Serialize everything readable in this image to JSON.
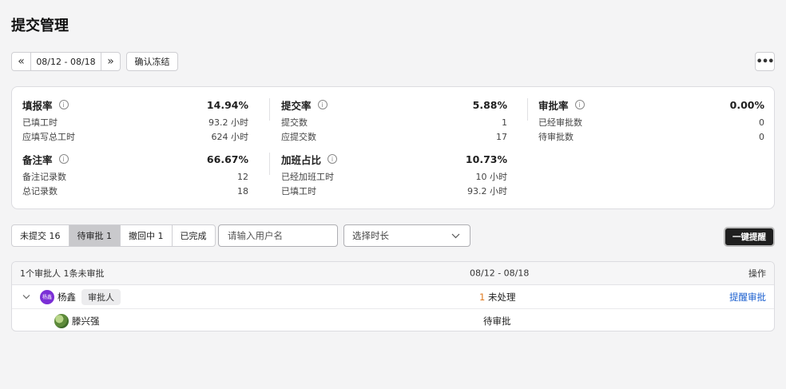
{
  "page": {
    "title": "提交管理"
  },
  "toolbar": {
    "date_range": "08/12 - 08/18",
    "prev_symbol": "«",
    "next_symbol": "»",
    "freeze_label": "确认冻结",
    "more_symbol": "•••"
  },
  "stats": {
    "fill": {
      "title": "填报率",
      "percent": "14.94%",
      "rows": [
        {
          "label": "已填工时",
          "value": "93.2 小时"
        },
        {
          "label": "应填写总工时",
          "value": "624 小时"
        }
      ]
    },
    "submit": {
      "title": "提交率",
      "percent": "5.88%",
      "rows": [
        {
          "label": "提交数",
          "value": "1"
        },
        {
          "label": "应提交数",
          "value": "17"
        }
      ]
    },
    "approve": {
      "title": "审批率",
      "percent": "0.00%",
      "rows": [
        {
          "label": "已经审批数",
          "value": "0"
        },
        {
          "label": "待审批数",
          "value": "0"
        }
      ]
    },
    "note": {
      "title": "备注率",
      "percent": "66.67%",
      "rows": [
        {
          "label": "备注记录数",
          "value": "12"
        },
        {
          "label": "总记录数",
          "value": "18"
        }
      ]
    },
    "overtime": {
      "title": "加班占比",
      "percent": "10.73%",
      "rows": [
        {
          "label": "已经加班工时",
          "value": "10 小时"
        },
        {
          "label": "已填工时",
          "value": "93.2 小时"
        }
      ]
    }
  },
  "filters": {
    "tabs": [
      {
        "label": "未提交 16"
      },
      {
        "label": "待审批 1"
      },
      {
        "label": "撤回中 1"
      },
      {
        "label": "已完成"
      }
    ],
    "active_tab_index": 1,
    "search_placeholder": "请输入用户名",
    "duration_placeholder": "选择时长",
    "remind_all_label": "一键提醒"
  },
  "table": {
    "header": {
      "summary": "1个审批人 1条未审批",
      "period": "08/12 - 08/18",
      "action": "操作"
    },
    "approver": {
      "avatar_text": "杨鑫",
      "name": "杨鑫",
      "role": "审批人",
      "pending_count": "1",
      "status": "未处理",
      "action": "提醒审批"
    },
    "member": {
      "name": "滕兴强",
      "status": "待审批"
    }
  },
  "colors": {
    "accent_link": "#1b5fcf",
    "pending_count": "#e07a20",
    "avatar_bg": "#7b2fd6",
    "primary_button": "#1f1f1f"
  }
}
